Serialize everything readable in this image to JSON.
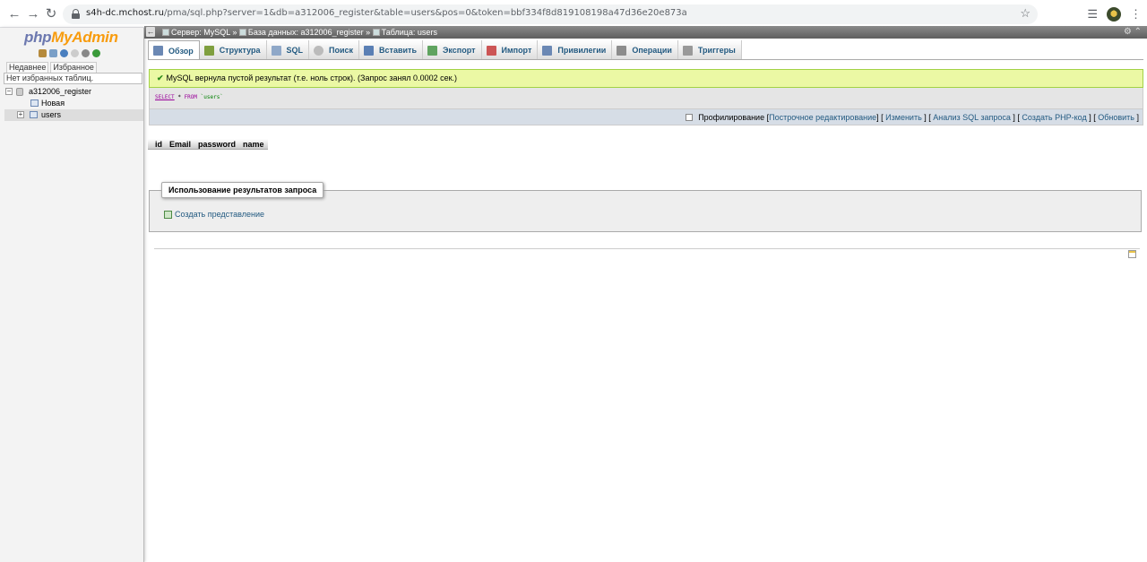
{
  "browser": {
    "url_host": "s4h-dc.mchost.ru",
    "url_path": "/pma/sql.php?server=1&db=a312006_register&table=users&pos=0&token=bbf334f8d819108198a47d36e20e873a"
  },
  "logo": {
    "php": "php",
    "myadmin": "MyAdmin"
  },
  "left": {
    "tabs": [
      "Недавнее",
      "Избранное"
    ],
    "favorites_text": "Нет избранных таблиц.",
    "tree": {
      "db": "a312006_register",
      "new": "Новая",
      "table": "users"
    }
  },
  "breadcrumb": {
    "server": "Сервер: MySQL",
    "sep": "»",
    "database": "База данных: a312006_register",
    "table": "Таблица: users"
  },
  "tabs": [
    {
      "label": "Обзор",
      "icon": "browse-icon",
      "color": "#6b88b4"
    },
    {
      "label": "Структура",
      "icon": "structure-icon",
      "color": "#7f9f3f"
    },
    {
      "label": "SQL",
      "icon": "sql-icon",
      "color": "#8fa8c8"
    },
    {
      "label": "Поиск",
      "icon": "search-icon",
      "color": "#bbbbbb"
    },
    {
      "label": "Вставить",
      "icon": "insert-icon",
      "color": "#5a7fb4"
    },
    {
      "label": "Экспорт",
      "icon": "export-icon",
      "color": "#5fa35f"
    },
    {
      "label": "Импорт",
      "icon": "import-icon",
      "color": "#c55"
    },
    {
      "label": "Привилегии",
      "icon": "privileges-icon",
      "color": "#6b88b4"
    },
    {
      "label": "Операции",
      "icon": "operations-icon",
      "color": "#8c8c8c"
    },
    {
      "label": "Триггеры",
      "icon": "triggers-icon",
      "color": "#999999"
    }
  ],
  "success_message": "MySQL вернула пустой результат (т.е. ноль строк). (Запрос занял 0.0002 сек.)",
  "sql": {
    "select": "SELECT",
    "star": "*",
    "from": "FROM",
    "table": "`users`"
  },
  "tools": {
    "profiling": "Профилирование",
    "links": [
      "Построчное редактирование",
      "Изменить",
      "Анализ SQL запроса",
      "Создать PHP-код",
      "Обновить"
    ]
  },
  "columns": [
    "id",
    "Email",
    "password",
    "name"
  ],
  "query_results": {
    "legend": "Использование результатов запроса",
    "create_view": "Создать представление"
  },
  "colors": {
    "link": "#235a81",
    "success_bg": "#ebf8a4",
    "topbar": "#6e6e6e"
  }
}
